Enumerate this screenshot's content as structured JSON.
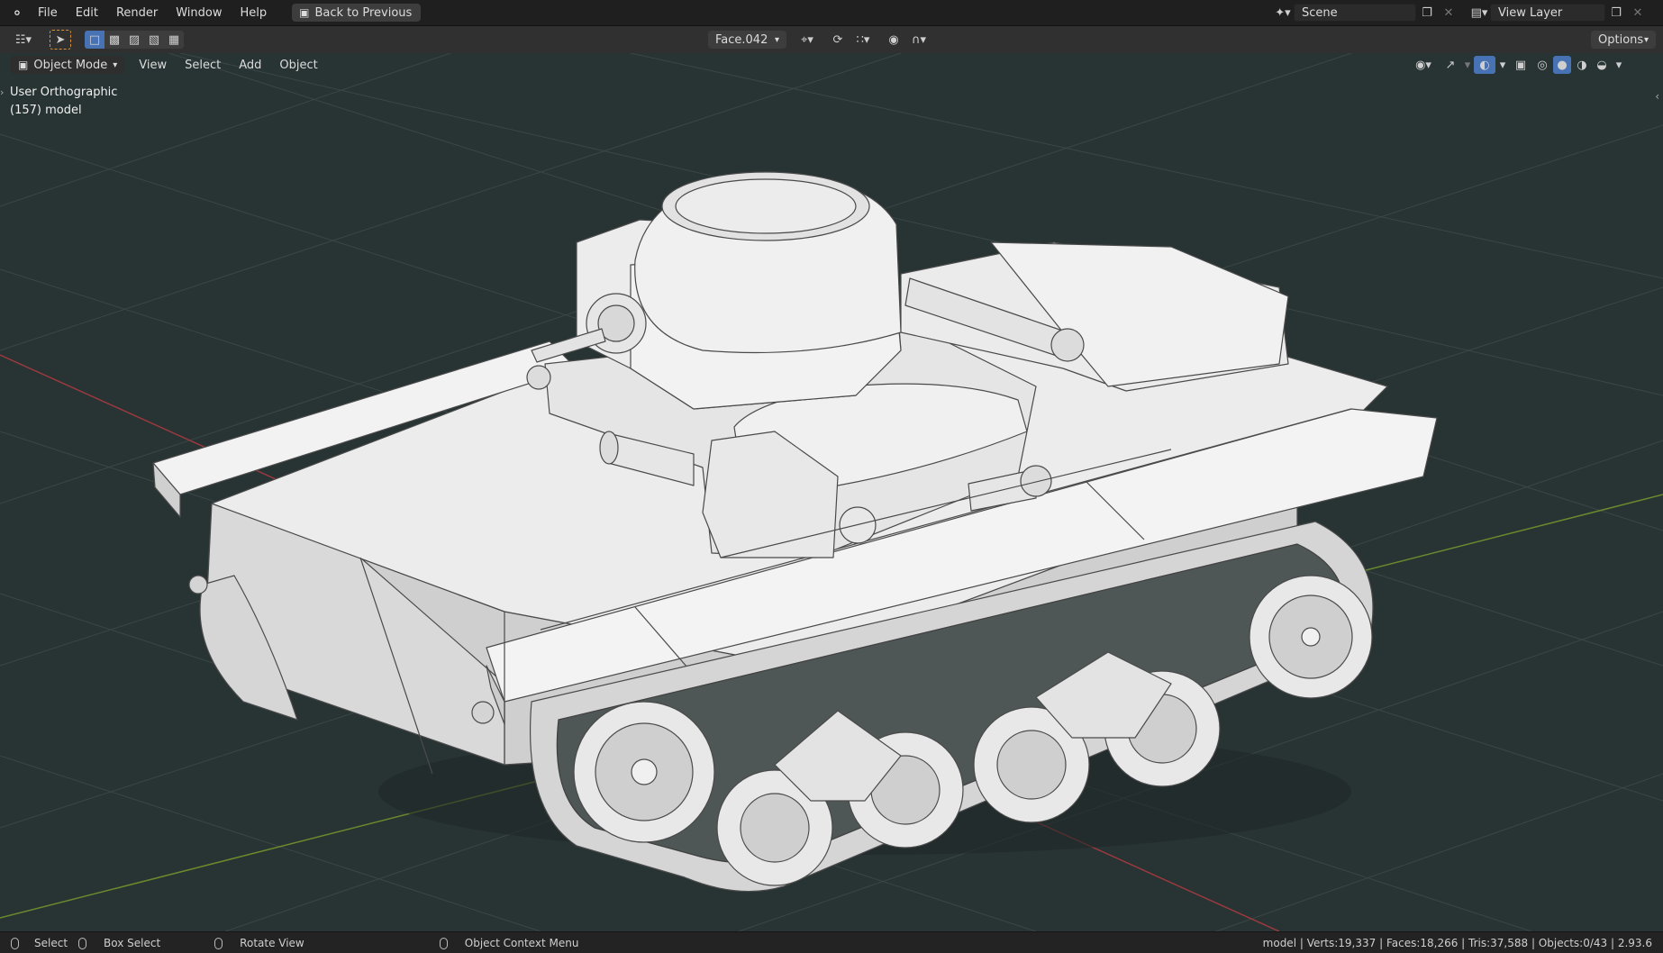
{
  "app": {
    "logo_icon": "blender-logo-icon"
  },
  "menu": [
    "File",
    "Edit",
    "Render",
    "Window",
    "Help"
  ],
  "back_button": {
    "label": "Back to Previous",
    "icon": "back-screen-icon"
  },
  "scene": {
    "value": "Scene"
  },
  "view_layer": {
    "value": "View Layer"
  },
  "toolbar": {
    "active_object_select": "Face.042",
    "options_label": "Options"
  },
  "viewport_header": {
    "mode": "Object Mode",
    "menus": [
      "View",
      "Select",
      "Add",
      "Object"
    ]
  },
  "overlay": {
    "view_name": "User Orthographic",
    "collection_info": "(157) model"
  },
  "statusbar": {
    "select": "Select",
    "box_select": "Box Select",
    "rotate_view": "Rotate View",
    "context_menu": "Object Context Menu",
    "stats": "model | Verts:19,337 | Faces:18,266 | Tris:37,588 | Objects:0/43 | 2.93.6"
  },
  "colors": {
    "viewport_bg": "#283333",
    "grid": "#3a4444",
    "x_axis": "#9a3a3f",
    "y_axis": "#6a8a2e",
    "accent": "#4772b3"
  }
}
